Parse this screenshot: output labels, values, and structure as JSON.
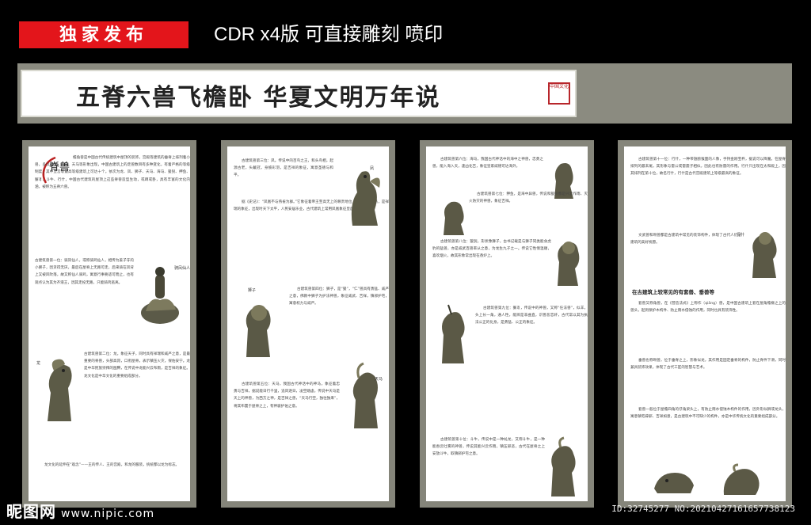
{
  "badge": "独家发布",
  "headline": "CDR x4版  可直接雕刻 喷印",
  "banner": {
    "title": "五脊六兽飞檐卧  华夏文明万年说",
    "seal": "中国文化"
  },
  "panels": [
    {
      "logo": "脊兽",
      "paragraphs": [
        "檐角兽是中国古代传统建筑中屋顶的装饰，宫殿等建筑的垂脊上排列着小兽，多以狮子、海马、天马等形象出现，中国古建筑上的走兽数目有多种变化，有着严格的等级制度，其中皇宫等最高等级建筑上可达十个。依次为龙、凤、狮子、天马、海马、狻猊、押鱼、獬豸、斗牛、行什，中国古代建筑的屋顶上这些脊兽造型生动，或蹲或卧，具有丰富的文化内涵，被称为五脊六兽。",
        "古建筑兽第一位：骑凤仙人，或称骑鸡仙人，相传为姜子牙的小舅子，因贪得无厌，最后在屋脊上无路可走，后来骑在凤背上又被风吹落，故又称仙人骑鸡，寓意行事要适可而止，也有观点认为其为齐湣王，因其走投无路，只能骑鸡逃离。",
        "古建筑兽第二位：龙。象征天子，同时具有祥瑞和威严之意，是最重要的脊兽，头部高昂，口衔屋脊，表示镇压火灾，保佑安宁。龙是中华民族崇拜的图腾，在传说中龙能兴云布雨，是吉祥的象征。龙文化是中华文化的重要组成部分。",
        "龙文化的延伸在“观念”——王的传人、王的宫殿，和龙的服装，统统都以龙为标志。"
      ],
      "captions": [
        "骑凤仙人",
        "龙"
      ]
    },
    {
      "paragraphs": [
        "古建筑兽第三位：凤。传说中的百鸟之王，和头鸟相，起源古老，头戴冠，身披彩羽，是吉祥的象征，寓意圣德与和平。",
        "据《史记》：“凤凰不与燕雀为群。”它象征着帝王至高无上的尊贵地位，它是一种仁鸟，是祥瑞的象征，出现时天下太平，人民安居乐业，古代建筑上常用凤凰象征皇后。",
        "古建筑兽第四位：狮子，是“狻”，“仁”兽具有勇猛、威严之意，佛教中狮子为护法神兽，象征威武、吉祥，镇邪护宅，寓意权力与威严。",
        "古建筑兽第五位：天马，我国古代神话中的神马，象征着忠勇与吉祥，据说能日行千里，追风逐日，凌空踏虚。传说中天马是天上的神兽，为西方之神，是吉祥之兽，“天马行空，独往独来”，将其布置于屋脊之上，有神骏护佑之意。"
      ],
      "captions": [
        "凤",
        "狮子",
        "天马"
      ]
    },
    {
      "paragraphs": [
        "古建筑兽第六位：海马，我国古代神话中的海中之神兽，忠勇之兽，能入海入天，逢凶化吉，象征皇家威德可达海外。",
        "古建筑兽第七位：狎鱼，是海中异兽，传说和狻猊都是兴云作雨、灭火防灾的神兽，象征吉祥。",
        "古建筑兽第八位：狻猊，形状像狮子，古书记载是与狮子同类能食虎豹的猛兽，亦是威武百兽率从之意，为龙生九子之一。传说它性情温顺，喜欢烟火，故其形象常出现在香炉上。",
        "古建筑兽第九位：獬豸，传说中的神兽，又称“任法兽”，似羊，头上长一角，通人性，能辨是非曲直，识善恶忠奸，古代常以其为执法公正的化身，是勇猛、公正的象征。",
        "古建筑兽第十位：斗牛，传说中是一种虬龙，又称斗牛，是一种能吞云吐雾的神兽，传说其能兴云作雨，镇压邪恶，古代在屋脊之上安放斗牛，取镇邪护宅之意。"
      ],
      "captions": [
        "海马",
        "狻猊",
        "獬豸",
        "斗牛"
      ]
    },
    {
      "paragraphs": [
        "古建筑兽第十一位：行什，一种带翅膀猴面的人像，手持金刚宝杵，据说可以降魔，在屋脊排列的最末尾，其形象与雷公或雷震子相似，因此也有防雷的作用。行什只出现在太和殿上，因其排列在第十位，故名行什，行什是古代宫殿建筑上等级最高的象征。",
        "文武兽和吻兽都是古建筑中常见的装饰构件，体现了古代人们对建筑的美好祝愿。"
      ],
      "subtitle": "在古建筑上较常见的有套兽、垂兽等",
      "paragraphs2": [
        "套兽又称角兽，在《营造法式》上称作（qiāng）兽，是中国古建筑上套在屋角檐椽之上的兽头，起到保护木构件、防止雨水侵蚀的作用，同时也具有装饰性。",
        "垂兽也称吻兽，位于垂脊之上，形象似龙，其作用是固定垂脊的构件，防止脊件下滑，同时兼具装饰效果，体现了古代工匠的智慧与艺术。",
        "套兽一般位于屋檐四角的仔角梁头上，有防止雨水侵蚀木构件的作用，因外形似狮或龙头，寓意镇宅辟邪、吉祥如意，是古建筑中不可缺少的构件，亦是中华传统文化的重要组成部分。"
      ],
      "captions": [
        "行什"
      ]
    }
  ],
  "footer": {
    "logo": "昵图网",
    "url": "www.nipic.com",
    "image_id": "ID:32745277 NO:20210427161657738123"
  }
}
